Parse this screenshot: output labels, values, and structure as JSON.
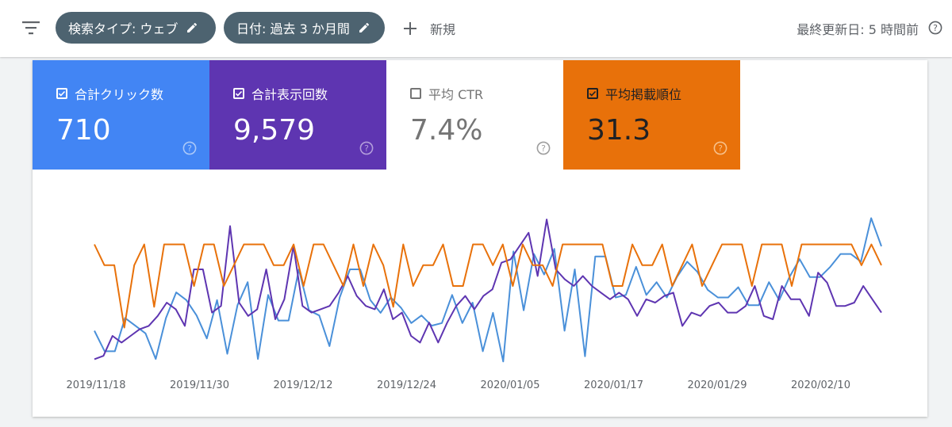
{
  "toolbar": {
    "filter_icon": "filter-list-icon",
    "chips": [
      {
        "label": "検索タイプ: ウェブ",
        "icon": "edit-pencil-icon"
      },
      {
        "label": "日付: 過去 3 か月間",
        "icon": "edit-pencil-icon"
      }
    ],
    "new_label": "新規",
    "last_updated": "最終更新日: 5 時間前",
    "help_icon": "help-circle-icon"
  },
  "metrics": [
    {
      "label": "合計クリック数",
      "value": "710",
      "checked": true,
      "color": "#4285f4"
    },
    {
      "label": "合計表示回数",
      "value": "9,579",
      "checked": true,
      "color": "#5e35b1"
    },
    {
      "label": "平均 CTR",
      "value": "7.4%",
      "checked": false,
      "color": "#ffffff"
    },
    {
      "label": "平均掲載順位",
      "value": "31.3",
      "checked": true,
      "color": "#e8710a"
    }
  ],
  "chart_data": {
    "type": "line",
    "x_tick_labels": [
      "2019/11/18",
      "2019/11/30",
      "2019/12/12",
      "2019/12/24",
      "2020/01/05",
      "2020/01/17",
      "2020/01/29",
      "2020/02/10"
    ],
    "grid": false,
    "legend": "none",
    "series": [
      {
        "name": "合計クリック数",
        "color": "#4a90d9",
        "values": [
          50,
          42,
          42,
          55,
          52,
          49,
          39,
          55,
          65,
          62,
          56,
          47,
          62,
          41,
          60,
          69,
          39,
          64,
          54,
          54,
          74,
          58,
          56,
          44,
          63,
          74,
          74,
          62,
          57,
          63,
          59,
          53,
          56,
          52,
          53,
          64,
          53,
          61,
          42,
          57,
          38,
          81,
          58,
          80,
          72,
          82,
          50,
          74,
          40,
          79,
          79,
          63,
          64,
          75,
          64,
          69,
          63,
          71,
          77,
          73,
          66,
          63,
          63,
          67,
          60,
          60,
          69,
          62,
          71,
          78,
          71,
          71,
          75,
          80,
          80,
          77,
          94,
          83
        ]
      },
      {
        "name": "合計表示回数",
        "color": "#5e35b1",
        "values": [
          48,
          49,
          55,
          53,
          55,
          57,
          58,
          61,
          65,
          63,
          58,
          75,
          75,
          62,
          64,
          88,
          65,
          61,
          63,
          75,
          60,
          66,
          82,
          64,
          62,
          63,
          64,
          68,
          73,
          67,
          64,
          63,
          69,
          60,
          62,
          55,
          53,
          59,
          53,
          59,
          64,
          67,
          63,
          67,
          69,
          77,
          78,
          82,
          86,
          73,
          90,
          75,
          72,
          70,
          73,
          70,
          68,
          66,
          68,
          66,
          61,
          66,
          65,
          67,
          68,
          58,
          62,
          61,
          64,
          65,
          62,
          62,
          64,
          70,
          61,
          60,
          70,
          66,
          66,
          61,
          74,
          71,
          64,
          64,
          65,
          70,
          66,
          62
        ]
      },
      {
        "name": "平均掲載順位",
        "color": "#e8710a",
        "values": [
          29,
          30,
          30,
          33,
          30,
          29,
          32,
          29,
          29,
          29,
          31,
          29,
          29,
          31,
          30,
          29,
          29,
          29,
          30,
          30,
          29,
          31,
          29,
          29,
          30,
          31,
          29,
          31,
          29,
          30,
          32,
          29,
          31,
          30,
          30,
          29,
          31,
          31,
          29,
          29,
          30,
          29,
          31,
          29,
          30,
          30,
          31,
          29,
          29,
          29,
          29,
          29,
          31,
          31,
          29,
          30,
          30,
          29,
          31,
          30,
          29,
          31,
          30,
          29,
          29,
          29,
          31,
          29,
          29,
          29,
          31,
          29,
          29,
          29,
          29,
          29,
          29,
          30,
          29,
          30
        ]
      }
    ]
  }
}
